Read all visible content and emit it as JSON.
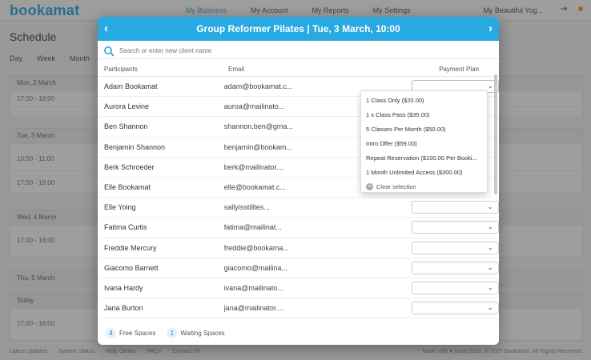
{
  "app": {
    "logo": "bookamat",
    "nav": [
      "My Business",
      "My Account",
      "My Reports",
      "My Settings"
    ],
    "business_name": "My Beautiful Yog...",
    "page_title": "Schedule",
    "views": [
      "Day",
      "Week",
      "Month"
    ]
  },
  "schedule": {
    "days": [
      {
        "label": "Mon, 2 March",
        "rows": [
          "17:00 - 18:00"
        ]
      },
      {
        "label": "Tue, 3 March",
        "rows": [
          "10:00 - 11:00",
          "17:00 - 18:00"
        ]
      },
      {
        "label": "Wed, 4 March",
        "rows": [
          "17:00 - 18:00"
        ]
      },
      {
        "label": "Thu, 5 March",
        "rows": []
      },
      {
        "label": "Today",
        "rows": [
          "17:00 - 18:00"
        ]
      }
    ]
  },
  "footer": {
    "links": [
      "Latest Updates",
      "System Status",
      "Help Center",
      "FAQs",
      "Contact Us"
    ],
    "right": "Made with ♥ since 2016. © 2020 Bookamat. All Rights Reserved."
  },
  "modal": {
    "title": "Group Reformer Pilates | Tue, 3 March, 10:00",
    "search_placeholder": "Search or enter new client name",
    "columns": {
      "participants": "Participants",
      "email": "Email",
      "payment_plan": "Payment Plan"
    },
    "participants": [
      {
        "name": "Adam Bookamat",
        "email": "adam@bookamat.c..."
      },
      {
        "name": "Aurora Levine",
        "email": "auroa@mailinato..."
      },
      {
        "name": "Ben Shannon",
        "email": "shannon.ben@gma..."
      },
      {
        "name": "Benjamin Shannon",
        "email": "benjamin@bookam..."
      },
      {
        "name": "Berk Schroeder",
        "email": "berk@mailinator...."
      },
      {
        "name": "Elle Bookamat",
        "email": "elle@bookamat.c..."
      },
      {
        "name": "Elle Yoing",
        "email": "sallyisstilltes..."
      },
      {
        "name": "Fatima Curtis",
        "email": "fatima@mailinat..."
      },
      {
        "name": "Freddie Mercury",
        "email": "freddie@bookama..."
      },
      {
        "name": "Giacomo Barnett",
        "email": "giacomo@mailina..."
      },
      {
        "name": "Ivana Hardy",
        "email": "ivana@mailinato..."
      },
      {
        "name": "Jana Burton",
        "email": "jana@mailinator...."
      }
    ],
    "plan_options": [
      "1 Class Only ($20.00)",
      "1 x Class Pass ($35.00)",
      "5 Classes Per Month ($50.00)",
      "Intro Offer ($59.00)",
      "Repeat Reservation ($100.00 Per Booki...",
      "1 Month Unlimited Access ($300.00)"
    ],
    "clear_label": "Clear selection",
    "free_spaces": {
      "count": "4",
      "label": "Free Spaces"
    },
    "waiting_spaces": {
      "count": "1",
      "label": "Waiting Spaces"
    }
  },
  "colors": {
    "accent": "#28a9e1"
  }
}
